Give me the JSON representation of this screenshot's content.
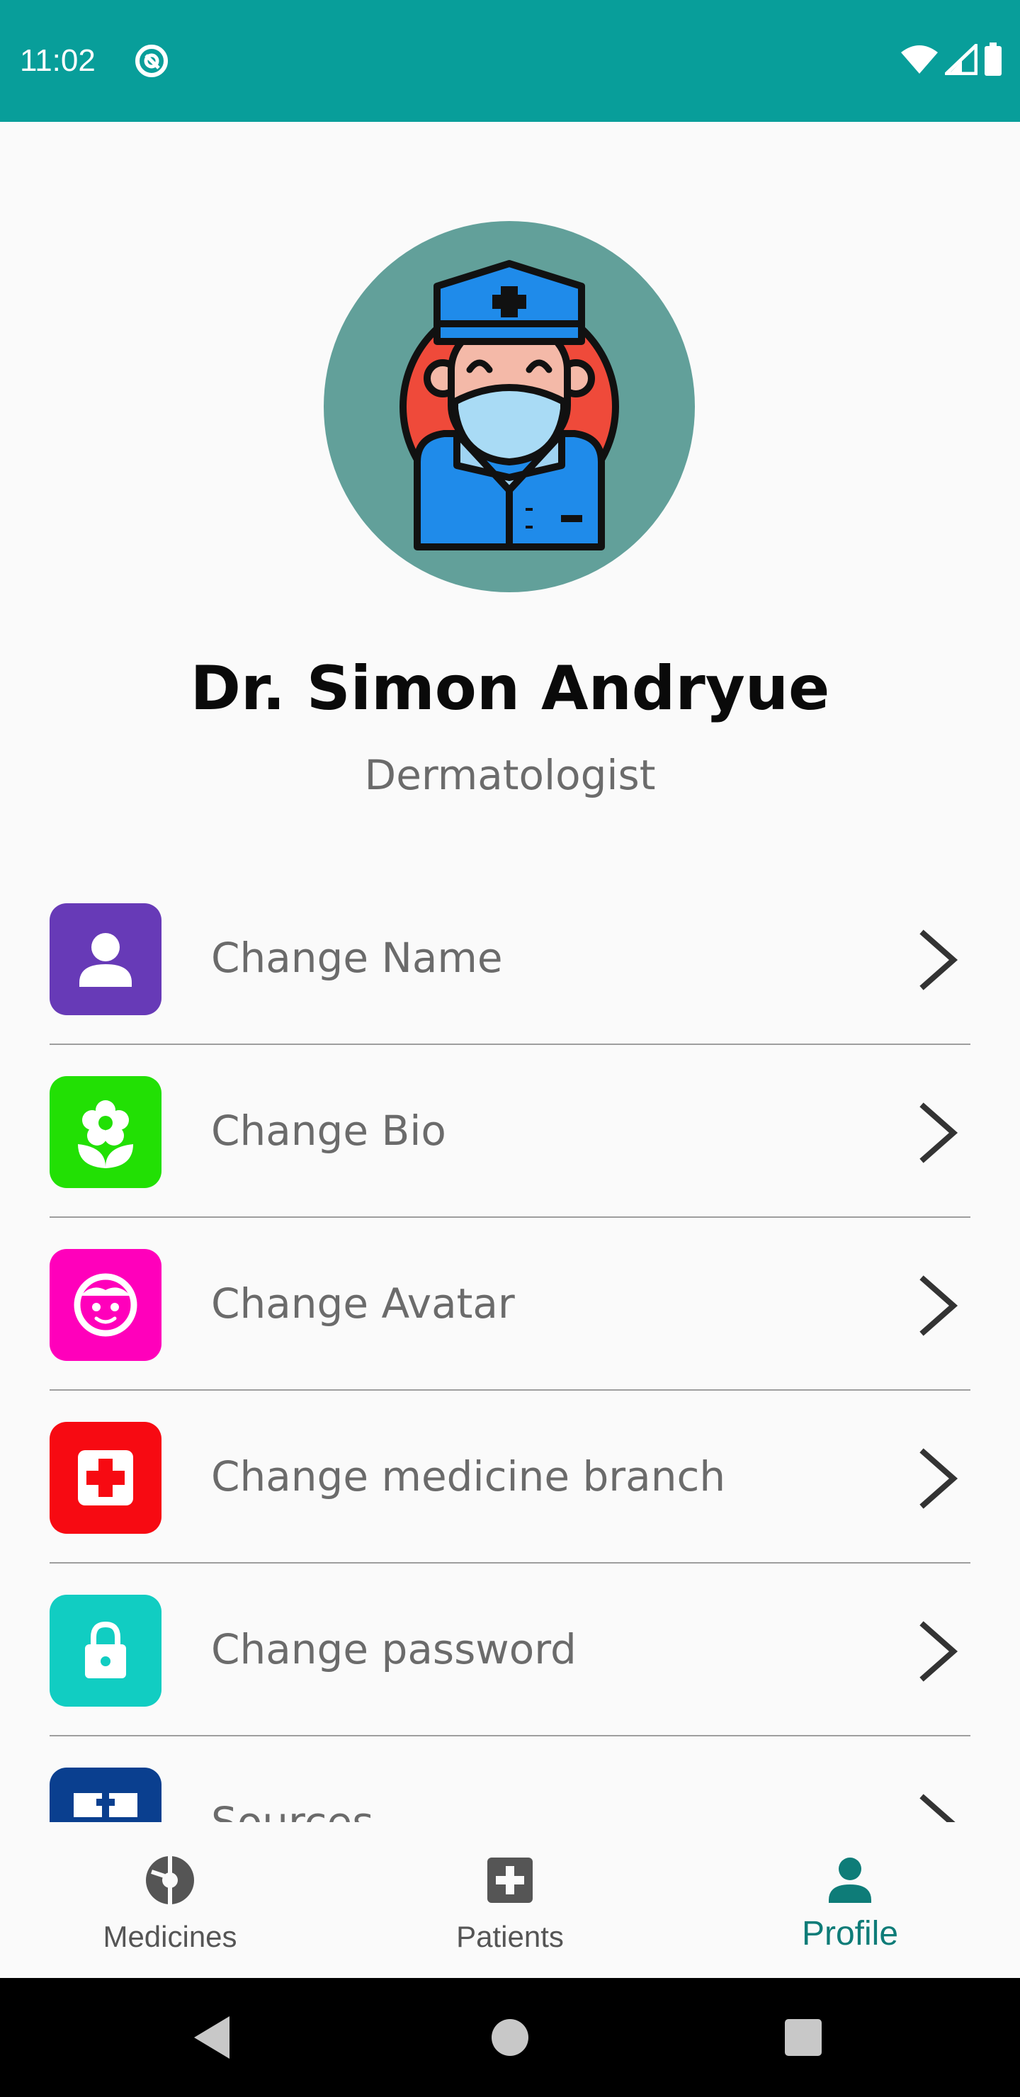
{
  "status_bar": {
    "time": "11:02",
    "background": "#089e9a",
    "icons": [
      "app-notification-icon",
      "wifi-icon",
      "signal-icon",
      "battery-icon"
    ]
  },
  "profile": {
    "name": "Dr. Simon Andryue",
    "specialty": "Dermatologist",
    "avatar_background": "#62a09a",
    "avatar_icon": "doctor-with-mask-icon"
  },
  "menu": {
    "items": [
      {
        "label": "Change Name",
        "icon": "person-icon",
        "icon_color": "#673ab7"
      },
      {
        "label": "Change Bio",
        "icon": "flower-icon",
        "icon_color": "#22e004"
      },
      {
        "label": "Change Avatar",
        "icon": "face-icon",
        "icon_color": "#ff00bb"
      },
      {
        "label": "Change medicine branch",
        "icon": "medical-cross-icon",
        "icon_color": "#f70a12"
      },
      {
        "label": "Change password",
        "icon": "lock-icon",
        "icon_color": "#11cdc2"
      },
      {
        "label": "Sources",
        "icon": "sources-icon",
        "icon_color": "#0a3f8f"
      }
    ]
  },
  "bottom_nav": {
    "items": [
      {
        "label": "Medicines",
        "icon": "medicines-icon",
        "active": false
      },
      {
        "label": "Patients",
        "icon": "patients-icon",
        "active": false
      },
      {
        "label": "Profile",
        "icon": "profile-icon",
        "active": true
      }
    ],
    "active_color": "#0e7c78",
    "inactive_color": "#555555"
  },
  "system_nav": {
    "buttons": [
      "back-icon",
      "home-icon",
      "recents-icon"
    ]
  }
}
